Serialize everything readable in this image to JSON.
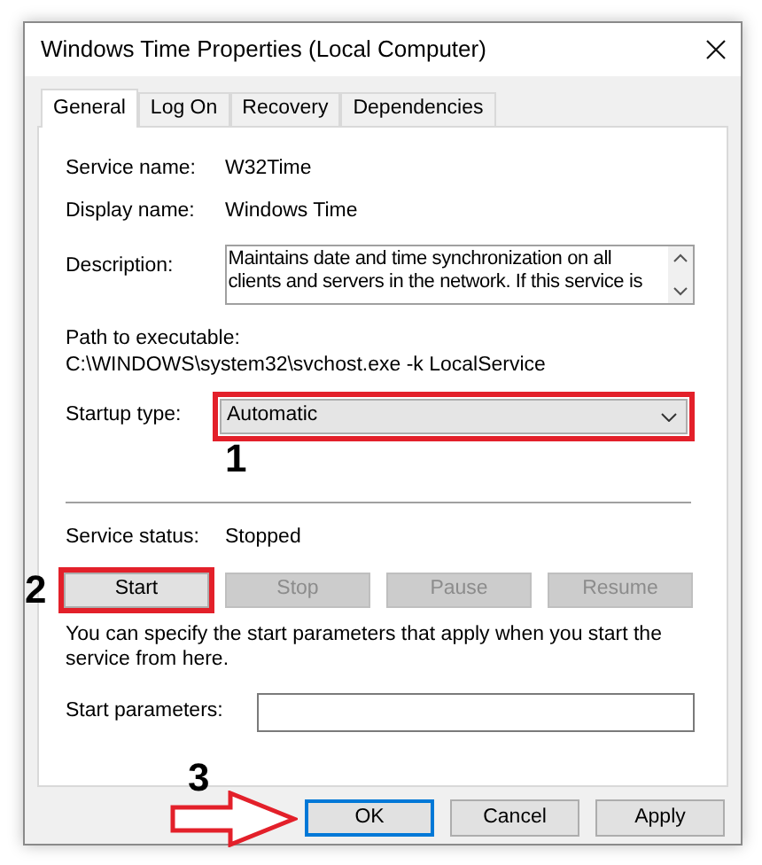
{
  "window": {
    "title": "Windows Time Properties (Local Computer)"
  },
  "tabs": [
    {
      "label": "General",
      "selected": true
    },
    {
      "label": "Log On",
      "selected": false
    },
    {
      "label": "Recovery",
      "selected": false
    },
    {
      "label": "Dependencies",
      "selected": false
    }
  ],
  "fields": [
    {
      "label": "Service name:",
      "value": "W32Time"
    },
    {
      "label": "Display name:",
      "value": "Windows Time"
    }
  ],
  "description": {
    "label": "Description:",
    "lines": [
      "Maintains date and time synchronization on all",
      "clients and servers in the network. If this service is"
    ]
  },
  "path": {
    "label": "Path to executable:",
    "value": "C:\\WINDOWS\\system32\\svchost.exe -k LocalService"
  },
  "startup_type": {
    "label": "Startup type:",
    "value": "Automatic",
    "annotation": {
      "kind": "box",
      "label": "1"
    }
  },
  "service_status": {
    "label": "Service status:",
    "value": "Stopped"
  },
  "service_buttons": [
    {
      "label": "Start",
      "disabled": false,
      "annotation": {
        "kind": "box",
        "label": "2"
      }
    },
    {
      "label": "Stop",
      "disabled": true
    },
    {
      "label": "Pause",
      "disabled": true
    },
    {
      "label": "Resume",
      "disabled": true
    }
  ],
  "hint": "You can specify the start parameters that apply when you start the service from here.",
  "start_parameters": {
    "label": "Start parameters:"
  },
  "dialog_buttons": [
    {
      "label": "OK",
      "default": true,
      "annotation": {
        "kind": "arrow",
        "label": "3"
      }
    },
    {
      "label": "Cancel",
      "default": false
    },
    {
      "label": "Apply",
      "default": false
    }
  ]
}
